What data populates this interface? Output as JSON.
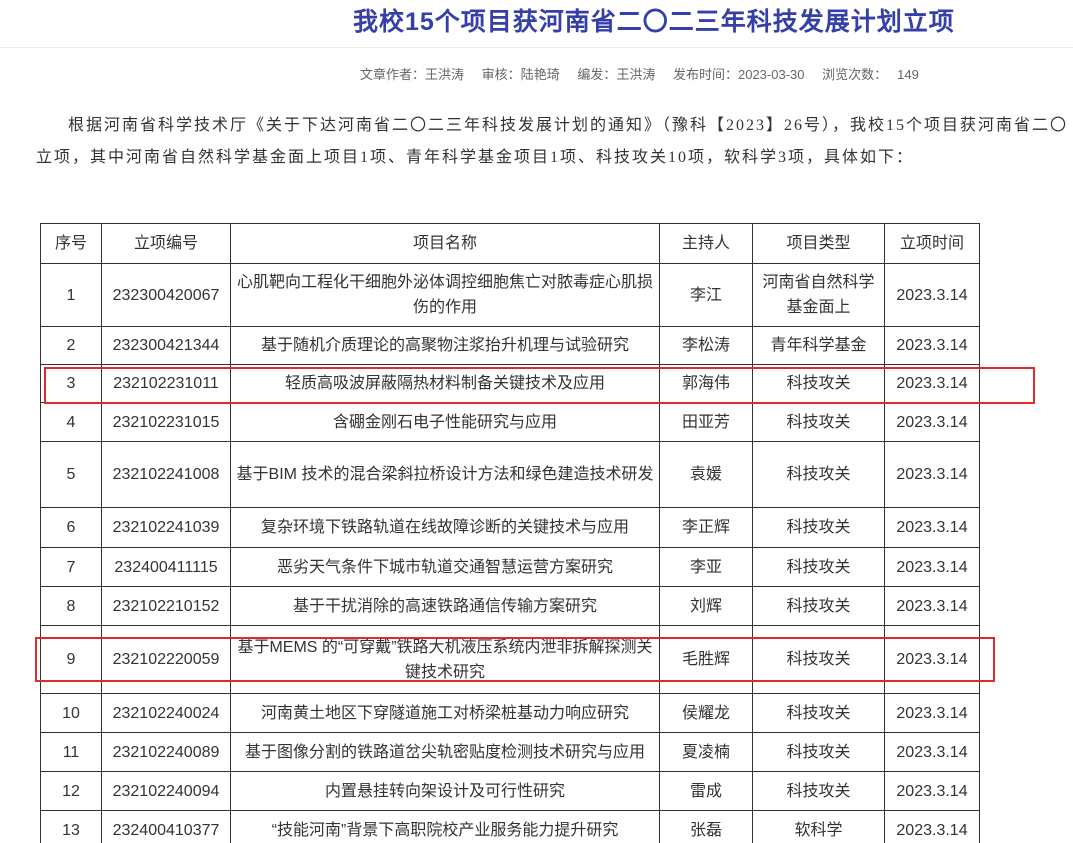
{
  "article": {
    "title": "我校15个项目获河南省二〇二三年科技发展计划立项",
    "meta": {
      "author_label": "文章作者：",
      "author": "王洪涛",
      "reviewer_label": "审核：",
      "reviewer": "陆艳琦",
      "editor_label": "编发：",
      "editor": "王洪涛",
      "published_label": "发布时间：",
      "published": "2023-03-30",
      "views_label": "浏览次数：",
      "views": "149"
    },
    "body": {
      "line1": "根据河南省科学技术厅《关于下达河南省二〇二三年科技发展计划的通知》（豫科【2023】26号），我校15个项目获河南省二〇",
      "line2": "立项，其中河南省自然科学基金面上项目1项、青年科学基金项目1项、科技攻关10项，软科学3项，具体如下："
    }
  },
  "table": {
    "headers": {
      "no": "序号",
      "code": "立项编号",
      "name": "项目名称",
      "leader": "主持人",
      "type": "项目类型",
      "date": "立项时间"
    },
    "rows": [
      {
        "no": "1",
        "code": "232300420067",
        "name": "心肌靶向工程化干细胞外泌体调控细胞焦亡对脓毒症心肌损伤的作用",
        "leader": "李江",
        "type": "河南省自然科学基金面上",
        "date": "2023.3.14"
      },
      {
        "no": "2",
        "code": "232300421344",
        "name": "基于随机介质理论的高聚物注浆抬升机理与试验研究",
        "leader": "李松涛",
        "type": "青年科学基金",
        "date": "2023.3.14"
      },
      {
        "no": "3",
        "code": "232102231011",
        "name": "轻质高吸波屏蔽隔热材料制备关键技术及应用",
        "leader": "郭海伟",
        "type": "科技攻关",
        "date": "2023.3.14"
      },
      {
        "no": "4",
        "code": "232102231015",
        "name": "含硼金刚石电子性能研究与应用",
        "leader": "田亚芳",
        "type": "科技攻关",
        "date": "2023.3.14"
      },
      {
        "no": "5",
        "code": "232102241008",
        "name": "基于BIM 技术的混合梁斜拉桥设计方法和绿色建造技术研发",
        "leader": "袁媛",
        "type": "科技攻关",
        "date": "2023.3.14"
      },
      {
        "no": "6",
        "code": "232102241039",
        "name": "复杂环境下铁路轨道在线故障诊断的关键技术与应用",
        "leader": "李正辉",
        "type": "科技攻关",
        "date": "2023.3.14"
      },
      {
        "no": "7",
        "code": "232400411115",
        "name": "恶劣天气条件下城市轨道交通智慧运营方案研究",
        "leader": "李亚",
        "type": "科技攻关",
        "date": "2023.3.14"
      },
      {
        "no": "8",
        "code": "232102210152",
        "name": "基于干扰消除的高速铁路通信传输方案研究",
        "leader": "刘辉",
        "type": "科技攻关",
        "date": "2023.3.14"
      },
      {
        "no": "9",
        "code": "232102220059",
        "name": "基于MEMS 的“可穿戴”铁路大机液压系统内泄非拆解探测关键技术研究",
        "leader": "毛胜辉",
        "type": "科技攻关",
        "date": "2023.3.14"
      },
      {
        "no": "10",
        "code": "232102240024",
        "name": "河南黄土地区下穿隧道施工对桥梁桩基动力响应研究",
        "leader": "侯耀龙",
        "type": "科技攻关",
        "date": "2023.3.14"
      },
      {
        "no": "11",
        "code": "232102240089",
        "name": "基于图像分割的铁路道岔尖轨密贴度检测技术研究与应用",
        "leader": "夏凌楠",
        "type": "科技攻关",
        "date": "2023.3.14"
      },
      {
        "no": "12",
        "code": "232102240094",
        "name": "内置悬挂转向架设计及可行性研究",
        "leader": "雷成",
        "type": "科技攻关",
        "date": "2023.3.14"
      },
      {
        "no": "13",
        "code": "232400410377",
        "name": "“技能河南”背景下高职院校产业服务能力提升研究",
        "leader": "张磊",
        "type": "软科学",
        "date": "2023.3.14"
      }
    ]
  },
  "colors": {
    "title": "#343fa8",
    "highlight_box": "#e02b2b",
    "table_border": "#333333",
    "meta_text": "#666666"
  }
}
